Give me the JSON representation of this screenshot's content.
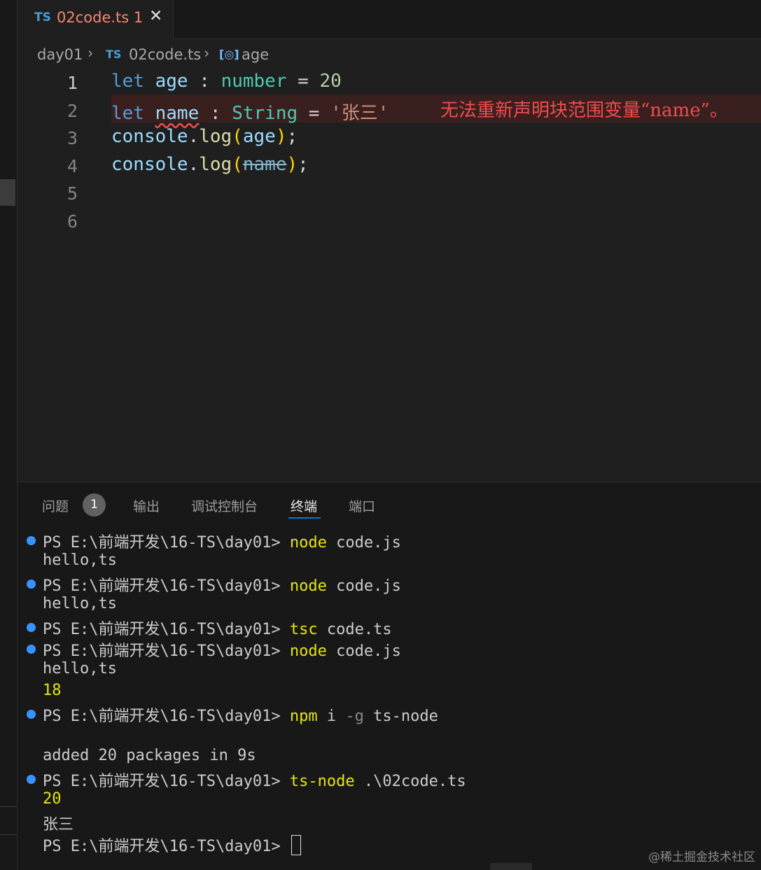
{
  "tab": {
    "icon": "TS",
    "filename": "02code.ts",
    "problem_count": "1",
    "close_glyph": "✕"
  },
  "breadcrumb": {
    "folder": "day01",
    "file_icon": "TS",
    "file": "02code.ts",
    "symbol_icon": "[◎]",
    "symbol": "age"
  },
  "editor": {
    "line_numbers": [
      "1",
      "2",
      "3",
      "4",
      "5",
      "6"
    ],
    "lines": [
      [
        {
          "t": "let",
          "c": "kw"
        },
        {
          "t": " ",
          "c": ""
        },
        {
          "t": "age",
          "c": "var"
        },
        {
          "t": " : ",
          "c": "op"
        },
        {
          "t": "number",
          "c": "type"
        },
        {
          "t": " = ",
          "c": "op"
        },
        {
          "t": "20",
          "c": "num"
        }
      ],
      [
        {
          "t": "let",
          "c": "kw"
        },
        {
          "t": " ",
          "c": ""
        },
        {
          "t": "name",
          "c": "var squiggle"
        },
        {
          "t": " : ",
          "c": "op"
        },
        {
          "t": "String",
          "c": "type"
        },
        {
          "t": " = ",
          "c": "op"
        },
        {
          "t": "'张三'",
          "c": "str"
        }
      ],
      [
        {
          "t": "console",
          "c": "var"
        },
        {
          "t": ".",
          "c": "op"
        },
        {
          "t": "log",
          "c": "fn"
        },
        {
          "t": "(",
          "c": "paren"
        },
        {
          "t": "age",
          "c": "var"
        },
        {
          "t": ")",
          "c": "paren"
        },
        {
          "t": ";",
          "c": "op"
        }
      ],
      [
        {
          "t": "console",
          "c": "var"
        },
        {
          "t": ".",
          "c": "op"
        },
        {
          "t": "log",
          "c": "fn"
        },
        {
          "t": "(",
          "c": "paren"
        },
        {
          "t": "name",
          "c": "strike"
        },
        {
          "t": ")",
          "c": "paren"
        },
        {
          "t": ";",
          "c": "op"
        }
      ]
    ],
    "inline_error": "无法重新声明块范围变量“name”。"
  },
  "panel": {
    "tabs": {
      "problems": "问题",
      "problems_badge": "1",
      "output": "输出",
      "debug_console": "调试控制台",
      "terminal": "终端",
      "ports": "端口"
    }
  },
  "terminal": {
    "lines": [
      {
        "dot": true,
        "parts": [
          {
            "t": "PS E:\\前端开发\\16-TS\\day01> ",
            "c": ""
          },
          {
            "t": "node",
            "c": "cmd"
          },
          {
            "t": " code.js",
            "c": ""
          }
        ]
      },
      {
        "dot": false,
        "parts": [
          {
            "t": "hello,ts",
            "c": ""
          }
        ]
      },
      {
        "dot": true,
        "parts": [
          {
            "t": "PS E:\\前端开发\\16-TS\\day01> ",
            "c": ""
          },
          {
            "t": "node",
            "c": "cmd"
          },
          {
            "t": " code.js",
            "c": ""
          }
        ]
      },
      {
        "dot": false,
        "parts": [
          {
            "t": "hello,ts",
            "c": ""
          }
        ]
      },
      {
        "dot": true,
        "parts": [
          {
            "t": "PS E:\\前端开发\\16-TS\\day01> ",
            "c": ""
          },
          {
            "t": "tsc",
            "c": "cmd"
          },
          {
            "t": " code.ts",
            "c": ""
          }
        ]
      },
      {
        "dot": true,
        "parts": [
          {
            "t": "PS E:\\前端开发\\16-TS\\day01> ",
            "c": ""
          },
          {
            "t": "node",
            "c": "cmd"
          },
          {
            "t": " code.js",
            "c": ""
          }
        ]
      },
      {
        "dot": false,
        "parts": [
          {
            "t": "hello,ts",
            "c": ""
          }
        ]
      },
      {
        "dot": false,
        "parts": [
          {
            "t": "18",
            "c": "yellow"
          }
        ]
      },
      {
        "dot": true,
        "parts": [
          {
            "t": "PS E:\\前端开发\\16-TS\\day01> ",
            "c": ""
          },
          {
            "t": "npm",
            "c": "cmd"
          },
          {
            "t": " i ",
            "c": ""
          },
          {
            "t": "-g",
            "c": "cmd-flag"
          },
          {
            "t": " ts-node",
            "c": ""
          }
        ]
      },
      {
        "dot": false,
        "parts": [
          {
            "t": "",
            "c": ""
          }
        ]
      },
      {
        "dot": false,
        "parts": [
          {
            "t": "added 20 packages in 9s",
            "c": ""
          }
        ]
      },
      {
        "dot": true,
        "parts": [
          {
            "t": "PS E:\\前端开发\\16-TS\\day01> ",
            "c": ""
          },
          {
            "t": "ts-node",
            "c": "cmd"
          },
          {
            "t": " .\\02code.ts",
            "c": ""
          }
        ]
      },
      {
        "dot": false,
        "parts": [
          {
            "t": "20",
            "c": "yellow"
          }
        ]
      },
      {
        "dot": false,
        "parts": [
          {
            "t": "张三",
            "c": ""
          }
        ]
      },
      {
        "dot": false,
        "cursor": true,
        "parts": [
          {
            "t": "PS E:\\前端开发\\16-TS\\day01> ",
            "c": ""
          }
        ]
      }
    ]
  },
  "watermark": "@稀土掘金技术社区",
  "colors": {
    "accent": "#0078d4",
    "error": "#f14c4c",
    "terminal_dot": "#3794ff",
    "terminal_command": "#e5e510"
  }
}
